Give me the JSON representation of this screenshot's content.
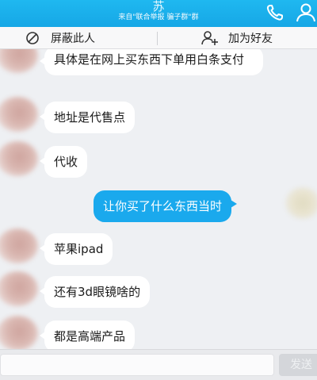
{
  "header": {
    "title": "苏",
    "subtitle": "来自\"联合举报 骗子群\"群"
  },
  "actions": {
    "block_label": "屏蔽此人",
    "add_friend_label": "加为好友"
  },
  "messages": [
    {
      "from": "other",
      "text": "具体是在网上买东西下单用白条支付"
    },
    {
      "from": "other",
      "text": "地址是代售点"
    },
    {
      "from": "other",
      "text": "代收"
    },
    {
      "from": "self",
      "text": "让你买了什么东西当时"
    },
    {
      "from": "other",
      "text": "苹果ipad"
    },
    {
      "from": "other",
      "text": "还有3d眼镜啥的"
    },
    {
      "from": "other",
      "text": "都是高端产品"
    }
  ],
  "input": {
    "send_label": "发送"
  },
  "colors": {
    "header": "#16a7e6",
    "self_bubble": "#1aa9ed",
    "other_bubble": "#ffffff",
    "background": "#eef0f3"
  },
  "icons": {
    "phone": "phone-icon",
    "profile": "person-icon",
    "block": "block-icon",
    "add_friend": "add-friend-icon"
  }
}
